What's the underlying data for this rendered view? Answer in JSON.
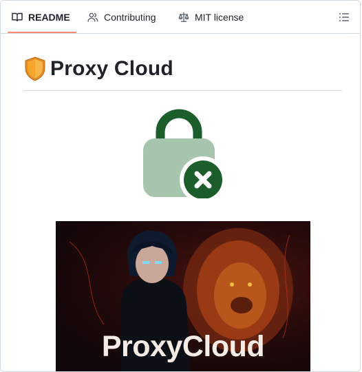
{
  "tabs": [
    {
      "label": "README",
      "icon": "book-icon",
      "active": true
    },
    {
      "label": "Contributing",
      "icon": "people-icon",
      "active": false
    },
    {
      "label": "MIT license",
      "icon": "law-scale-icon",
      "active": false
    }
  ],
  "toolbar": {
    "outline_icon": "list-unordered-icon"
  },
  "readme": {
    "title": "Proxy Cloud",
    "title_emoji": "shield-icon",
    "logo_icon": "lock-cross-icon",
    "banner_text": "ProxyCloud"
  },
  "colors": {
    "active_tab_underline": "#fd8c73",
    "lock_dark_green": "#1b5e2c",
    "lock_light_green": "#a7c4ad",
    "shield_orange": "#f4a52a",
    "banner_text": "#f6ece6"
  }
}
